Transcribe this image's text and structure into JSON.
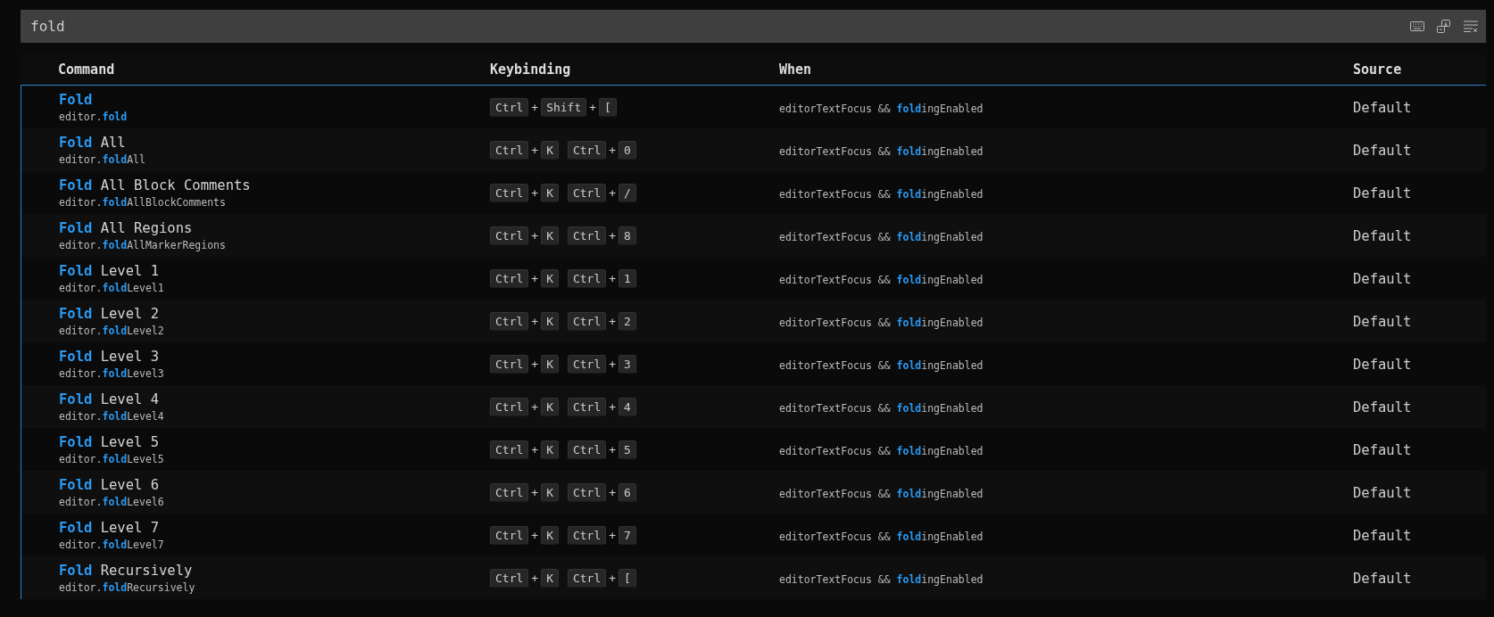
{
  "search": {
    "value": "fold"
  },
  "columns": [
    "Command",
    "Keybinding",
    "When",
    "Source"
  ],
  "list": {
    "focused": true
  },
  "rows": [
    {
      "title": "**Fold**",
      "id": "editor.**fold**",
      "chords": [
        [
          "Ctrl",
          "+",
          "Shift",
          "+",
          "["
        ]
      ],
      "when": "editorTextFocus && **fold**ingEnabled",
      "source": "Default"
    },
    {
      "title": "**Fold** All",
      "id": "editor.**fold**All",
      "chords": [
        [
          "Ctrl",
          "+",
          "K"
        ],
        [
          "Ctrl",
          "+",
          "0"
        ]
      ],
      "when": "editorTextFocus && **fold**ingEnabled",
      "source": "Default"
    },
    {
      "title": "**Fold** All Block Comments",
      "id": "editor.**fold**AllBlockComments",
      "chords": [
        [
          "Ctrl",
          "+",
          "K"
        ],
        [
          "Ctrl",
          "+",
          "/"
        ]
      ],
      "when": "editorTextFocus && **fold**ingEnabled",
      "source": "Default"
    },
    {
      "title": "**Fold** All Regions",
      "id": "editor.**fold**AllMarkerRegions",
      "chords": [
        [
          "Ctrl",
          "+",
          "K"
        ],
        [
          "Ctrl",
          "+",
          "8"
        ]
      ],
      "when": "editorTextFocus && **fold**ingEnabled",
      "source": "Default"
    },
    {
      "title": "**Fold** Level 1",
      "id": "editor.**fold**Level1",
      "chords": [
        [
          "Ctrl",
          "+",
          "K"
        ],
        [
          "Ctrl",
          "+",
          "1"
        ]
      ],
      "when": "editorTextFocus && **fold**ingEnabled",
      "source": "Default"
    },
    {
      "title": "**Fold** Level 2",
      "id": "editor.**fold**Level2",
      "chords": [
        [
          "Ctrl",
          "+",
          "K"
        ],
        [
          "Ctrl",
          "+",
          "2"
        ]
      ],
      "when": "editorTextFocus && **fold**ingEnabled",
      "source": "Default"
    },
    {
      "title": "**Fold** Level 3",
      "id": "editor.**fold**Level3",
      "chords": [
        [
          "Ctrl",
          "+",
          "K"
        ],
        [
          "Ctrl",
          "+",
          "3"
        ]
      ],
      "when": "editorTextFocus && **fold**ingEnabled",
      "source": "Default"
    },
    {
      "title": "**Fold** Level 4",
      "id": "editor.**fold**Level4",
      "chords": [
        [
          "Ctrl",
          "+",
          "K"
        ],
        [
          "Ctrl",
          "+",
          "4"
        ]
      ],
      "when": "editorTextFocus && **fold**ingEnabled",
      "source": "Default"
    },
    {
      "title": "**Fold** Level 5",
      "id": "editor.**fold**Level5",
      "chords": [
        [
          "Ctrl",
          "+",
          "K"
        ],
        [
          "Ctrl",
          "+",
          "5"
        ]
      ],
      "when": "editorTextFocus && **fold**ingEnabled",
      "source": "Default"
    },
    {
      "title": "**Fold** Level 6",
      "id": "editor.**fold**Level6",
      "chords": [
        [
          "Ctrl",
          "+",
          "K"
        ],
        [
          "Ctrl",
          "+",
          "6"
        ]
      ],
      "when": "editorTextFocus && **fold**ingEnabled",
      "source": "Default"
    },
    {
      "title": "**Fold** Level 7",
      "id": "editor.**fold**Level7",
      "chords": [
        [
          "Ctrl",
          "+",
          "K"
        ],
        [
          "Ctrl",
          "+",
          "7"
        ]
      ],
      "when": "editorTextFocus && **fold**ingEnabled",
      "source": "Default"
    },
    {
      "title": "**Fold** Recursively",
      "id": "editor.**fold**Recursively",
      "chords": [
        [
          "Ctrl",
          "+",
          "K"
        ],
        [
          "Ctrl",
          "+",
          "["
        ]
      ],
      "when": "editorTextFocus && **fold**ingEnabled",
      "source": "Default"
    }
  ]
}
